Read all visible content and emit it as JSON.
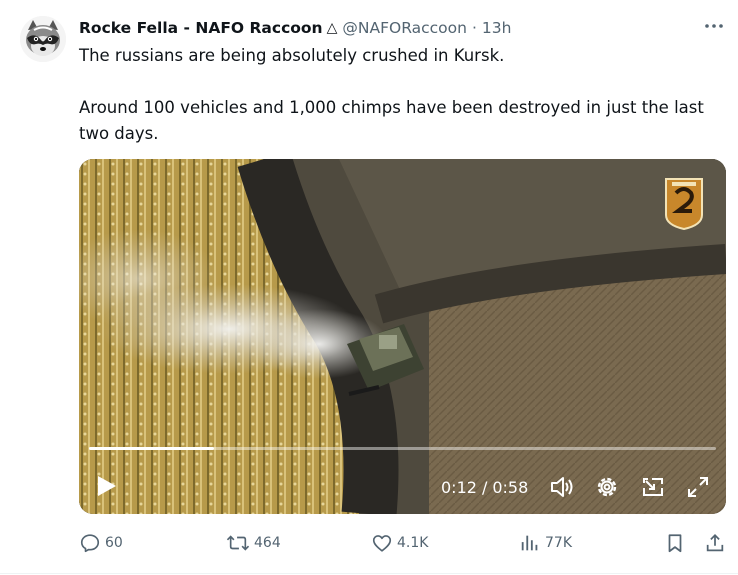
{
  "tweet": {
    "display_name": "Rocke Fella - NAFO Raccoon",
    "verified_symbol": "△",
    "handle": "@NAFORaccoon",
    "separator": "·",
    "time": "13h",
    "more_label": "•••",
    "text_line_1": "The russians are being absolutely crushed in Kursk.",
    "text_line_2": "Around 100 vehicles and 1,000 chimps have been destroyed in just the last two days."
  },
  "video": {
    "current_time": "0:12",
    "separator": "/",
    "duration": "0:58",
    "progress": 0.2,
    "icons": [
      "play-icon",
      "volume-icon",
      "settings-icon",
      "picture-in-picture-icon",
      "fullscreen-icon"
    ]
  },
  "actions": {
    "replies": "60",
    "reposts": "464",
    "likes": "4.1K",
    "views": "77K"
  },
  "colors": {
    "text": "#0f1419",
    "secondary": "#536471",
    "badge": "#c8872b"
  }
}
